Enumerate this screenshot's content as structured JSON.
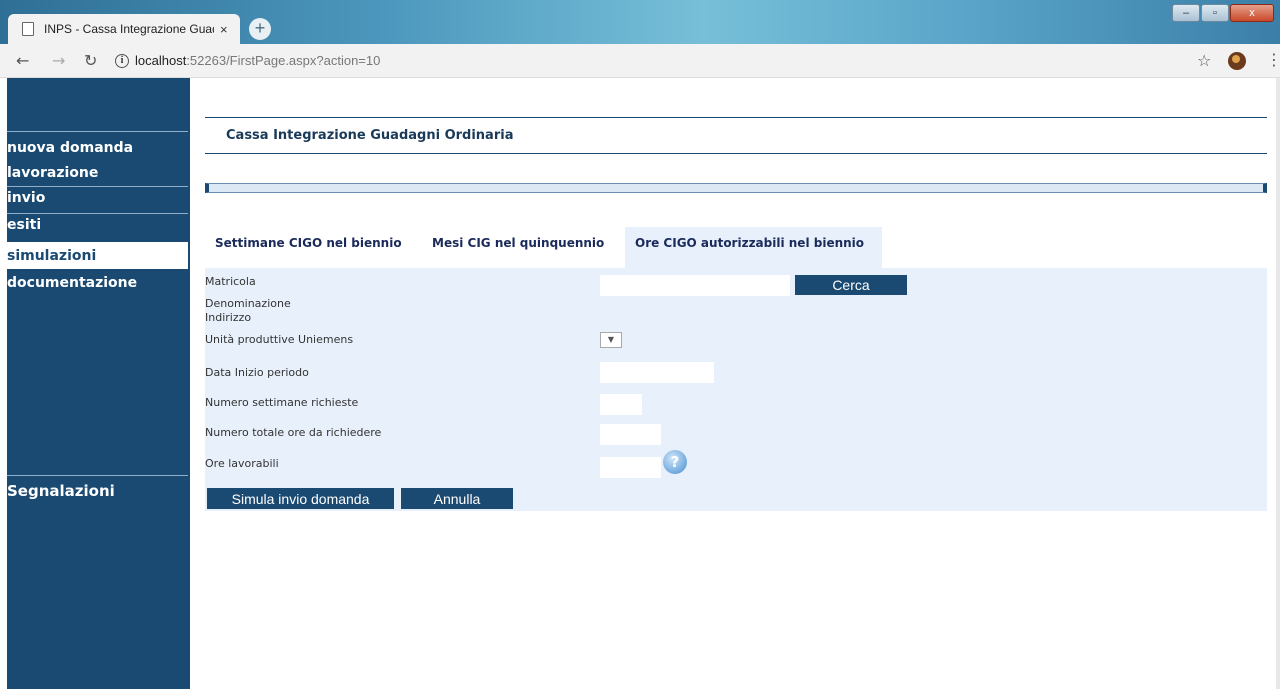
{
  "browser": {
    "tab_title": "INPS - Cassa Integrazione Guada",
    "tab_close": "×",
    "new_tab": "+",
    "url_host": "localhost",
    "url_rest": ":52263/FirstPage.aspx?action=10",
    "window_buttons": [
      "–",
      "▫",
      "x"
    ]
  },
  "sidebar": {
    "items": [
      {
        "label": "nuova domanda"
      },
      {
        "label": "lavorazione"
      },
      {
        "label": "invio"
      },
      {
        "label": "esiti"
      },
      {
        "label": "simulazioni"
      },
      {
        "label": "documentazione"
      }
    ],
    "active_item": "simulazioni",
    "segnalazioni": "Segnalazioni"
  },
  "page": {
    "title": "Cassa Integrazione Guadagni Ordinaria",
    "tabs": [
      {
        "label": "Settimane CIGO nel biennio"
      },
      {
        "label": "Mesi CIG nel quinquennio"
      },
      {
        "label": "Ore CIGO autorizzabili nel biennio"
      }
    ],
    "active_tab": "Ore CIGO autorizzabili nel biennio"
  },
  "form": {
    "matricola_label": "Matricola",
    "matricola_value": "",
    "cerca_button": "Cerca",
    "denominazione_label": "Denominazione",
    "indirizzo_label": "Indirizzo",
    "unita_label": "Unità produttive Uniemens",
    "unita_selected": "",
    "data_inizio_label": "Data Inizio periodo",
    "data_inizio_value": "",
    "settimane_label": "Numero settimane richieste",
    "settimane_value": "",
    "ore_totali_label": "Numero totale ore da richiedere",
    "ore_totali_value": "",
    "ore_lavorabili_label": "Ore lavorabili",
    "ore_lavorabili_value": "",
    "simula_button": "Simula invio domanda",
    "annulla_button": "Annulla"
  },
  "colors": {
    "brand": "#1a4a72",
    "panel": "#e8f1fb"
  }
}
